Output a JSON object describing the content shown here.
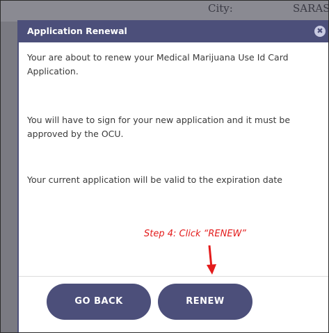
{
  "background": {
    "city_label": "City:",
    "city_value": "SARAS"
  },
  "dialog": {
    "title": "Application Renewal",
    "close_icon": "close-icon",
    "paragraphs": [
      "Your are about to renew your Medical Marijuana Use Id Card Application.",
      "You will have to sign for your new application and it must be approved by the OCU.",
      "Your current application will be valid to the expiration date"
    ],
    "buttons": {
      "go_back": "GO BACK",
      "renew": "RENEW"
    }
  },
  "annotation": {
    "text": "Step 4: Click “RENEW”",
    "color": "#e31b1b"
  },
  "colors": {
    "accent": "#4c4f7a",
    "text": "#3a3a3a"
  }
}
